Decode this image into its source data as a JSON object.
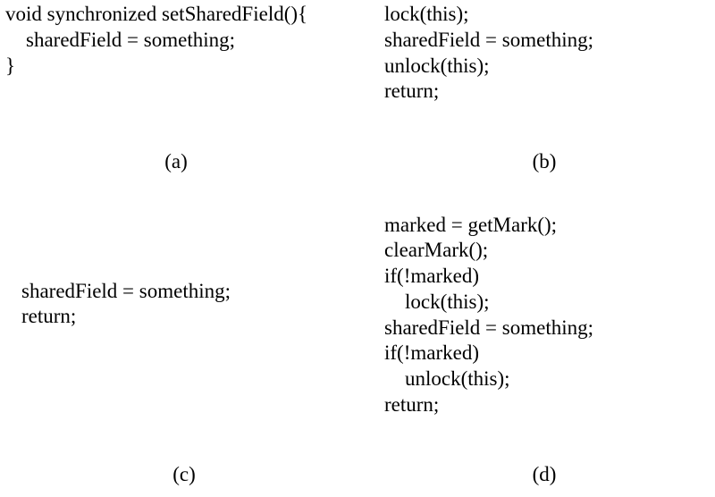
{
  "panels": {
    "a": {
      "label": "(a)",
      "code": "void synchronized setSharedField(){\n    sharedField = something;\n}"
    },
    "b": {
      "label": "(b)",
      "code": "lock(this);\nsharedField = something;\nunlock(this);\nreturn;"
    },
    "c": {
      "label": "(c)",
      "code": "sharedField = something;\nreturn;"
    },
    "d": {
      "label": "(d)",
      "code": "marked = getMark();\nclearMark();\nif(!marked)\n    lock(this);\nsharedField = something;\nif(!marked)\n    unlock(this);\nreturn;"
    }
  }
}
